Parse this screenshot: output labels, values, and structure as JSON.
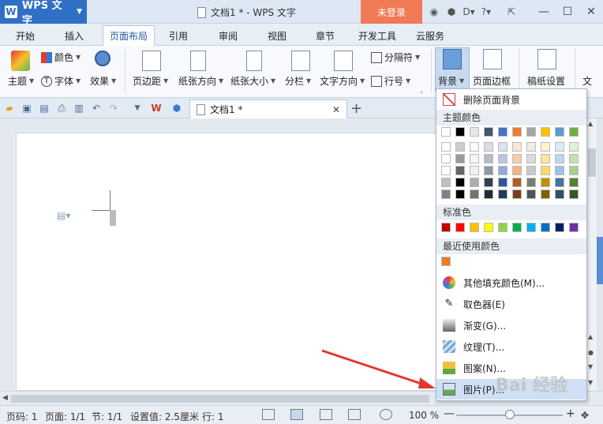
{
  "app": {
    "name": "WPS 文字",
    "logo_letter": "W"
  },
  "window": {
    "title": "文档1 * - WPS 文字",
    "login_label": "未登录"
  },
  "menu_tabs": [
    "开始",
    "插入",
    "页面布局",
    "引用",
    "审阅",
    "视图",
    "章节",
    "开发工具",
    "云服务"
  ],
  "active_tab": "页面布局",
  "ribbon": {
    "theme": "主题",
    "colors": "颜色",
    "font": "字体",
    "effects": "效果",
    "margins": "页边距",
    "orientation": "纸张方向",
    "size": "纸张大小",
    "columns": "分栏",
    "text_direction": "文字方向",
    "breaks": "分隔符",
    "line_numbers": "行号",
    "background": "背景",
    "page_border": "页面边框",
    "paper_setup": "稿纸设置",
    "more": "文"
  },
  "doc_tab": {
    "label": "文档1 *"
  },
  "dropdown": {
    "remove_background": "删除页面背景",
    "theme_colors_header": "主题颜色",
    "standard_colors_header": "标准色",
    "recent_colors_header": "最近使用颜色",
    "more_fill_colors": "其他填充颜色(M)...",
    "color_picker": "取色器(E)",
    "gradient": "渐变(G)...",
    "texture": "纹理(T)...",
    "pattern": "图案(N)...",
    "picture": "图片(P)...",
    "theme_row0": [
      "#ffffff",
      "#000000",
      "#e7e6e6",
      "#44546a",
      "#4472c4",
      "#ed7d31",
      "#a5a5a5",
      "#ffc000",
      "#5b9bd5",
      "#70ad47"
    ],
    "standard_colors": [
      "#c00000",
      "#ff0000",
      "#ffc000",
      "#ffff00",
      "#92d050",
      "#00b050",
      "#00b0f0",
      "#0070c0",
      "#002060",
      "#7030a0"
    ],
    "recent_colors": [
      "#f07a20"
    ]
  },
  "status": {
    "page_num": "页码: 1",
    "pages": "页面: 1/1",
    "section": "节: 1/1",
    "setting": "设置值: 2.5厘米",
    "line": "行: 1",
    "zoom": "100 %"
  },
  "watermark": "Bai 经验"
}
